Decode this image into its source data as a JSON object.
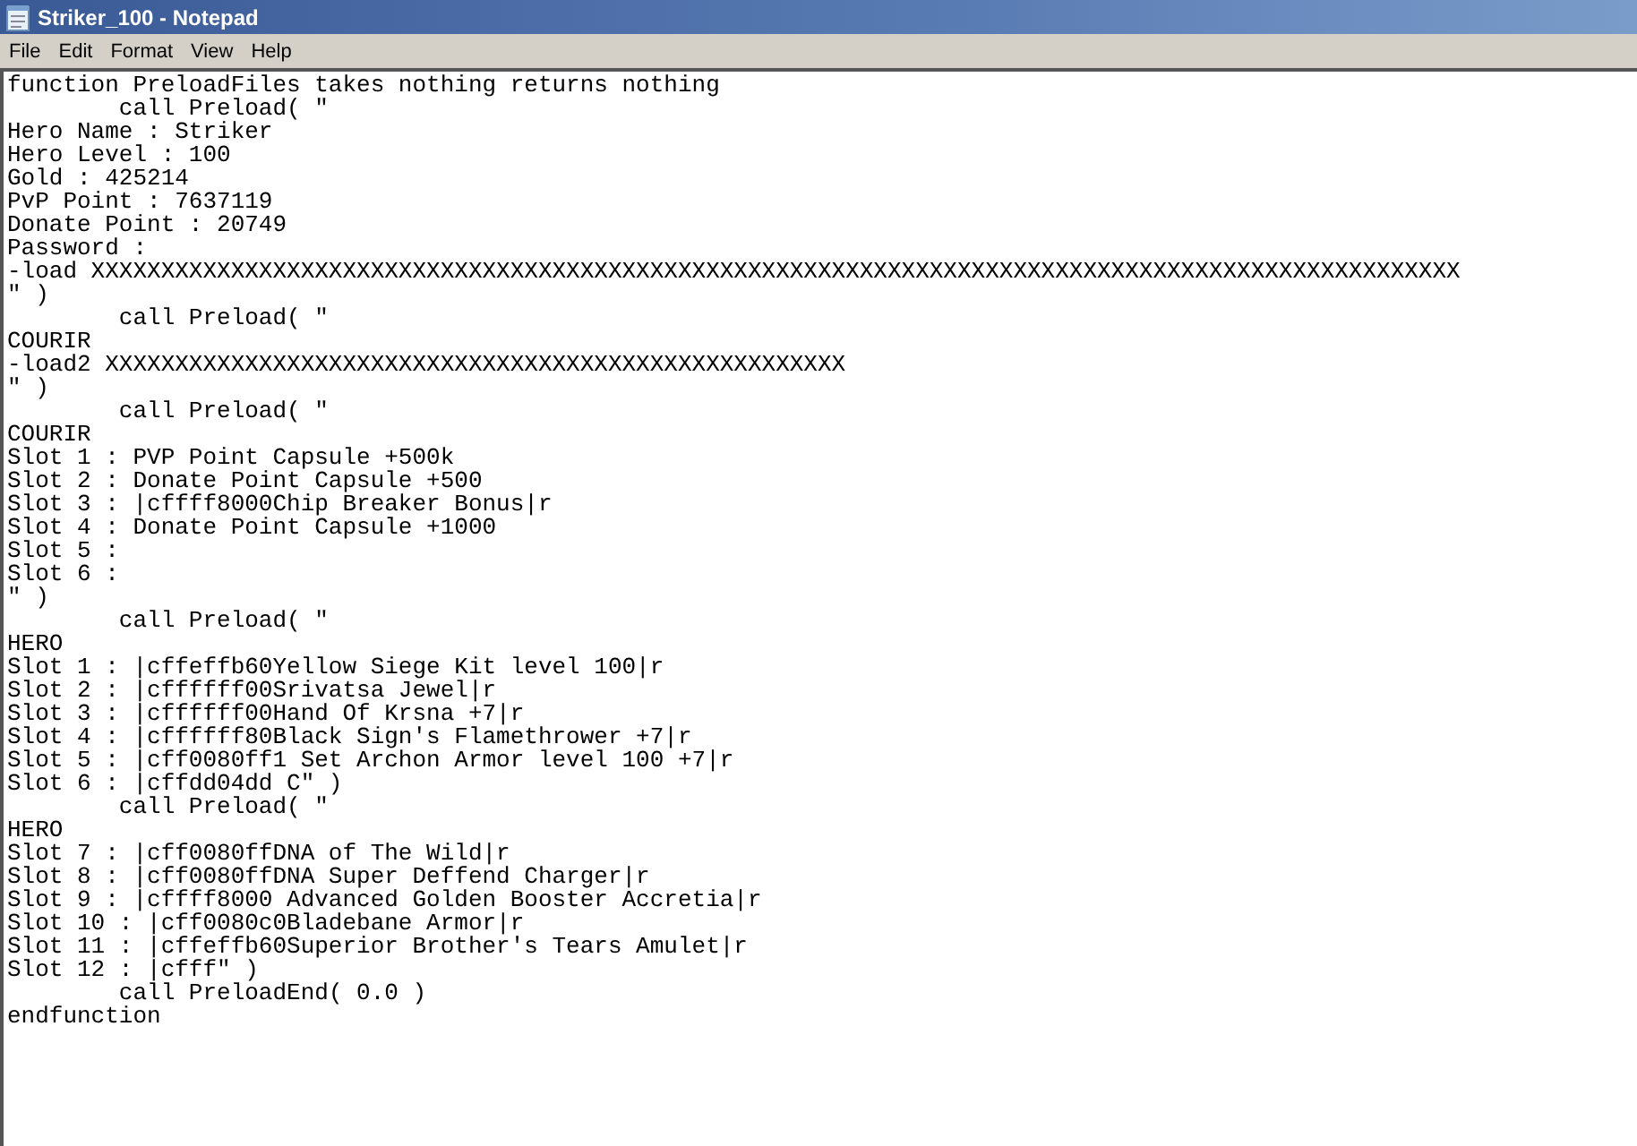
{
  "window": {
    "title": "Striker_100 - Notepad"
  },
  "menu": [
    "File",
    "Edit",
    "Format",
    "View",
    "Help"
  ],
  "lines": [
    "function PreloadFiles takes nothing returns nothing",
    "\tcall Preload( \"",
    "Hero Name : Striker",
    "Hero Level : 100",
    "Gold : 425214",
    "PvP Point : 7637119",
    "Donate Point : 20749",
    "Password :",
    "-load XXXXXXXXXXXXXXXXXXXXXXXXXXXXXXXXXXXXXXXXXXXXXXXXXXXXXXXXXXXXXXXXXXXXXXXXXXXXXXXXXXXXXXXXXXXXXXXXXX",
    "\" )",
    "\tcall Preload( \"",
    "COURIR",
    "-load2 XXXXXXXXXXXXXXXXXXXXXXXXXXXXXXXXXXXXXXXXXXXXXXXXXXXXX",
    "\" )",
    "\tcall Preload( \"",
    "COURIR",
    "Slot 1 : PVP Point Capsule +500k",
    "Slot 2 : Donate Point Capsule +500",
    "Slot 3 : |cffff8000Chip Breaker Bonus|r",
    "Slot 4 : Donate Point Capsule +1000",
    "Slot 5 :",
    "Slot 6 :",
    "\" )",
    "\tcall Preload( \"",
    "HERO",
    "Slot 1 : |cffeffb60Yellow Siege Kit level 100|r",
    "Slot 2 : |cffffff00Srivatsa Jewel|r",
    "Slot 3 : |cffffff00Hand Of Krsna +7|r",
    "Slot 4 : |cffffff80Black Sign's Flamethrower +7|r",
    "Slot 5 : |cff0080ff1 Set Archon Armor level 100 +7|r",
    "Slot 6 : |cffdd04dd C\" )",
    "\tcall Preload( \"",
    "HERO",
    "Slot 7 : |cff0080ffDNA of The Wild|r",
    "Slot 8 : |cff0080ffDNA Super Deffend Charger|r",
    "Slot 9 : |cffff8000 Advanced Golden Booster Accretia|r",
    "Slot 10 : |cff0080c0Bladebane Armor|r",
    "Slot 11 : |cffeffb60Superior Brother's Tears Amulet|r",
    "Slot 12 : |cfff\" )",
    "\tcall PreloadEnd( 0.0 )",
    "endfunction"
  ]
}
